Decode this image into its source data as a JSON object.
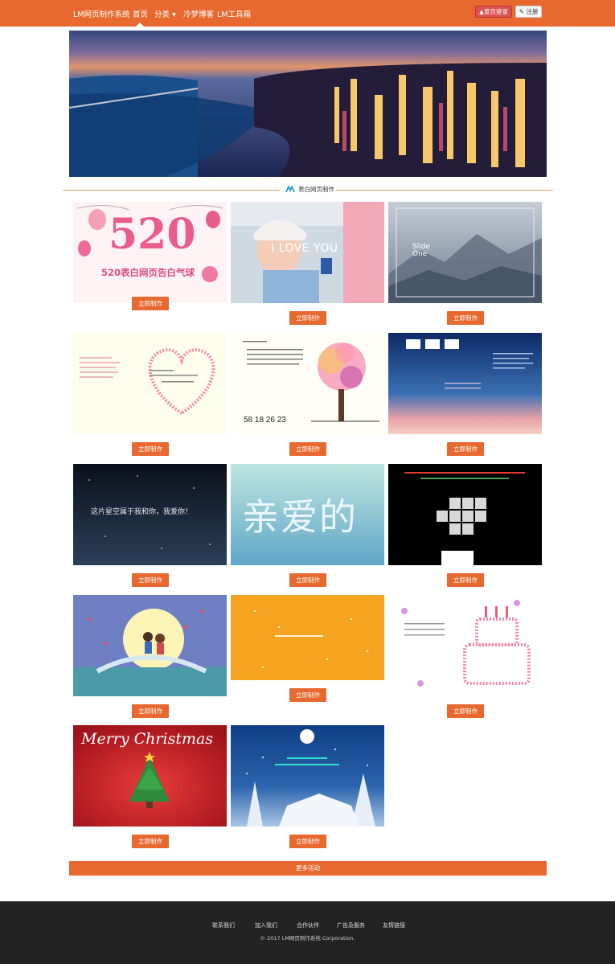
{
  "navbar": {
    "brand": "LM网页制作系统",
    "links": [
      "首页",
      "分类 ▾",
      "冷梦博客",
      "LM工具箱"
    ],
    "login_label": "▲意页登录",
    "register_label": "✎ 注册"
  },
  "section": {
    "title": "表白网页制作"
  },
  "cards": [
    {
      "caption": "520表白网页告白气球",
      "big_text": "520",
      "button": "立即制作"
    },
    {
      "caption": "I LOVE YOU",
      "button": "立即制作"
    },
    {
      "caption": "Slide One",
      "button": "立即制作"
    },
    {
      "caption": "",
      "button": "立即制作"
    },
    {
      "caption": "",
      "button": "立即制作"
    },
    {
      "caption": "",
      "button": "立即制作"
    },
    {
      "caption": "这片星空属于我和你，我爱你！",
      "button": "立即制作"
    },
    {
      "caption": "亲爱的",
      "button": "立即制作"
    },
    {
      "caption": "",
      "button": "立即制作"
    },
    {
      "caption": "",
      "button": "立即制作"
    },
    {
      "caption": "",
      "button": "立即制作"
    },
    {
      "caption": "",
      "button": "立即制作"
    },
    {
      "caption": "Merry Christmas",
      "button": "立即制作"
    },
    {
      "caption": "",
      "button": "立即制作"
    }
  ],
  "more_label": "更多活动",
  "footer": {
    "links": [
      "联系我们",
      "加入我们",
      "合作伙伴",
      "广告及服务",
      "友情链接"
    ],
    "copyright": "© 2017 LM网页制作系统 Corporation."
  },
  "colors": {
    "accent": "#e8692f",
    "footer_bg": "#232323"
  }
}
